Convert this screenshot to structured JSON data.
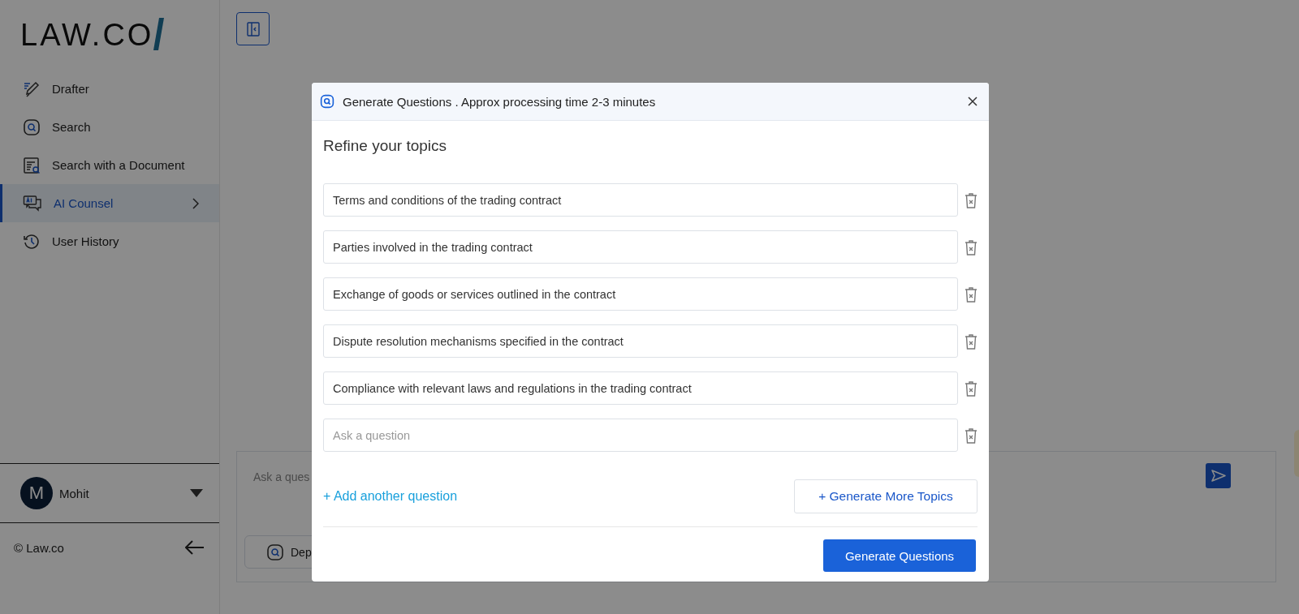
{
  "logo": {
    "text": "LAW.CO"
  },
  "sidebar": {
    "items": [
      {
        "label": "Drafter",
        "selected": false
      },
      {
        "label": "Search",
        "selected": false
      },
      {
        "label": "Search with a Document",
        "selected": false
      },
      {
        "label": "AI Counsel",
        "selected": true,
        "expandable": true
      },
      {
        "label": "User History",
        "selected": false
      }
    ],
    "user": {
      "initial": "M",
      "name": "Mohit"
    },
    "footer": "© Law.co"
  },
  "chat": {
    "placeholder": "Ask a ques",
    "mode_button": "Dep"
  },
  "modal": {
    "title": "Generate Questions . Approx processing time 2-3 minutes",
    "heading": "Refine your topics",
    "topics": [
      {
        "value": "Terms and conditions of the trading contract"
      },
      {
        "value": "Parties involved in the trading contract"
      },
      {
        "value": "Exchange of goods or services outlined in the contract"
      },
      {
        "value": "Dispute resolution mechanisms specified in the contract"
      },
      {
        "value": "Compliance with relevant laws and regulations in the trading contract"
      },
      {
        "placeholder": "Ask a question"
      }
    ],
    "add_link": "+ Add another question",
    "more_button": "+ Generate More Topics",
    "submit_button": "Generate Questions"
  }
}
